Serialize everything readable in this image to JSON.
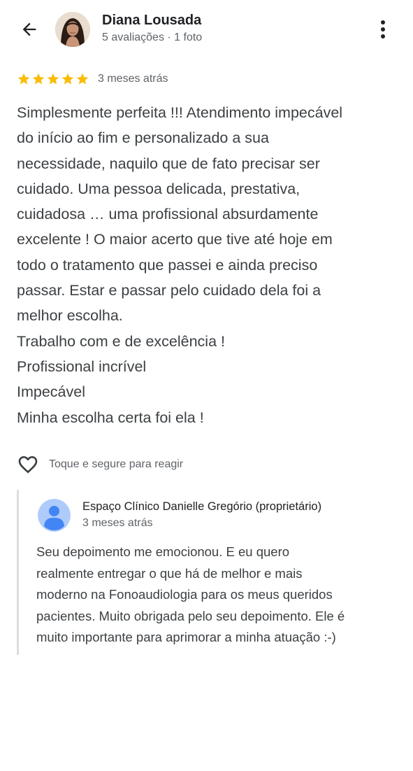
{
  "header": {
    "back_icon": "arrow-back-icon",
    "reviewer_name": "Diana Lousada",
    "reviewer_meta": "5 avaliações · 1 foto",
    "more_icon": "more-vert-icon"
  },
  "rating": {
    "stars": 5,
    "max_stars": 5,
    "star_color": "#fbbc04",
    "time": "3 meses atrás"
  },
  "review": {
    "lines": [
      "Simplesmente perfeita !!! Atendimento impecável",
      "do início ao fim e personalizado a sua",
      "necessidade, naquilo que de fato precisar ser",
      "cuidado. Uma pessoa delicada, prestativa,",
      "cuidadosa … uma profissional absurdamente",
      "excelente ! O maior acerto que tive até hoje em",
      "todo o tratamento que passei e ainda preciso",
      "passar. Estar e passar pelo cuidado dela foi a",
      "melhor escolha.",
      "Trabalho com e de excelência !",
      "Profissional incrível",
      "Impecável",
      "Minha escolha certa foi ela !"
    ]
  },
  "react": {
    "icon": "heart-outline-icon",
    "label": "Toque e segure para reagir"
  },
  "owner_reply": {
    "avatar_icon": "person-avatar-icon",
    "avatar_color": "#aecbfa",
    "avatar_person_color": "#4285f4",
    "name": "Espaço Clínico Danielle Gregório (proprietário)",
    "time": "3 meses atrás",
    "lines": [
      "Seu depoimento me emocionou. E eu quero",
      "realmente entregar o que há de melhor e mais",
      "moderno na Fonoaudiologia para os meus queridos",
      "pacientes. Muito obrigada pelo seu depoimento. Ele é",
      "muito importante para aprimorar a minha atuação :-)"
    ]
  }
}
